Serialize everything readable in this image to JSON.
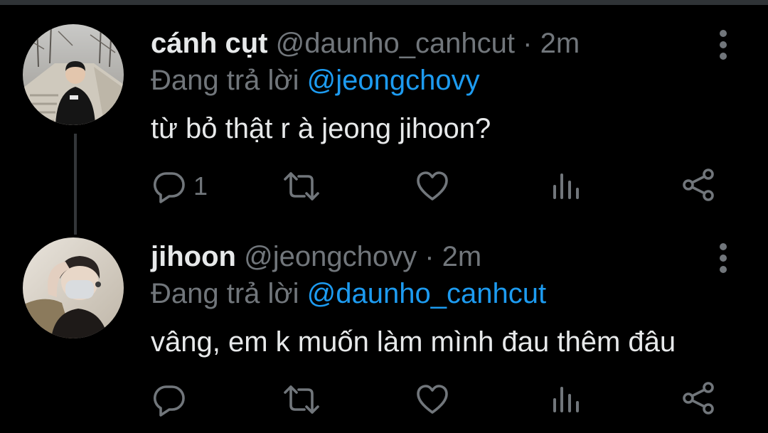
{
  "thread": [
    {
      "display_name": "cánh cụt",
      "handle": "@daunho_canhcut",
      "separator": "·",
      "time": "2m",
      "reply_prefix": "Đang trả lời",
      "reply_to": "@jeongchovy",
      "text": "từ bỏ thật r à jeong jihoon?",
      "reply_count": "1",
      "avatar_icon": "person-photo-avatar"
    },
    {
      "display_name": "jihoon",
      "handle": "@jeongchovy",
      "separator": "·",
      "time": "2m",
      "reply_prefix": "Đang trả lời",
      "reply_to": "@daunho_canhcut",
      "text": "vâng, em k muốn làm mình đau thêm đâu",
      "reply_count": "",
      "avatar_icon": "person-photo-avatar"
    }
  ],
  "icons": {
    "reply": "reply-icon",
    "retweet": "retweet-icon",
    "like": "heart-icon",
    "analytics": "analytics-icon",
    "share": "share-icon",
    "more": "more-vertical-icon"
  },
  "colors": {
    "background": "#000000",
    "primary_text": "#e7e9ea",
    "secondary_text": "#71767b",
    "accent": "#1d9bf0",
    "thread_line": "#333639"
  }
}
